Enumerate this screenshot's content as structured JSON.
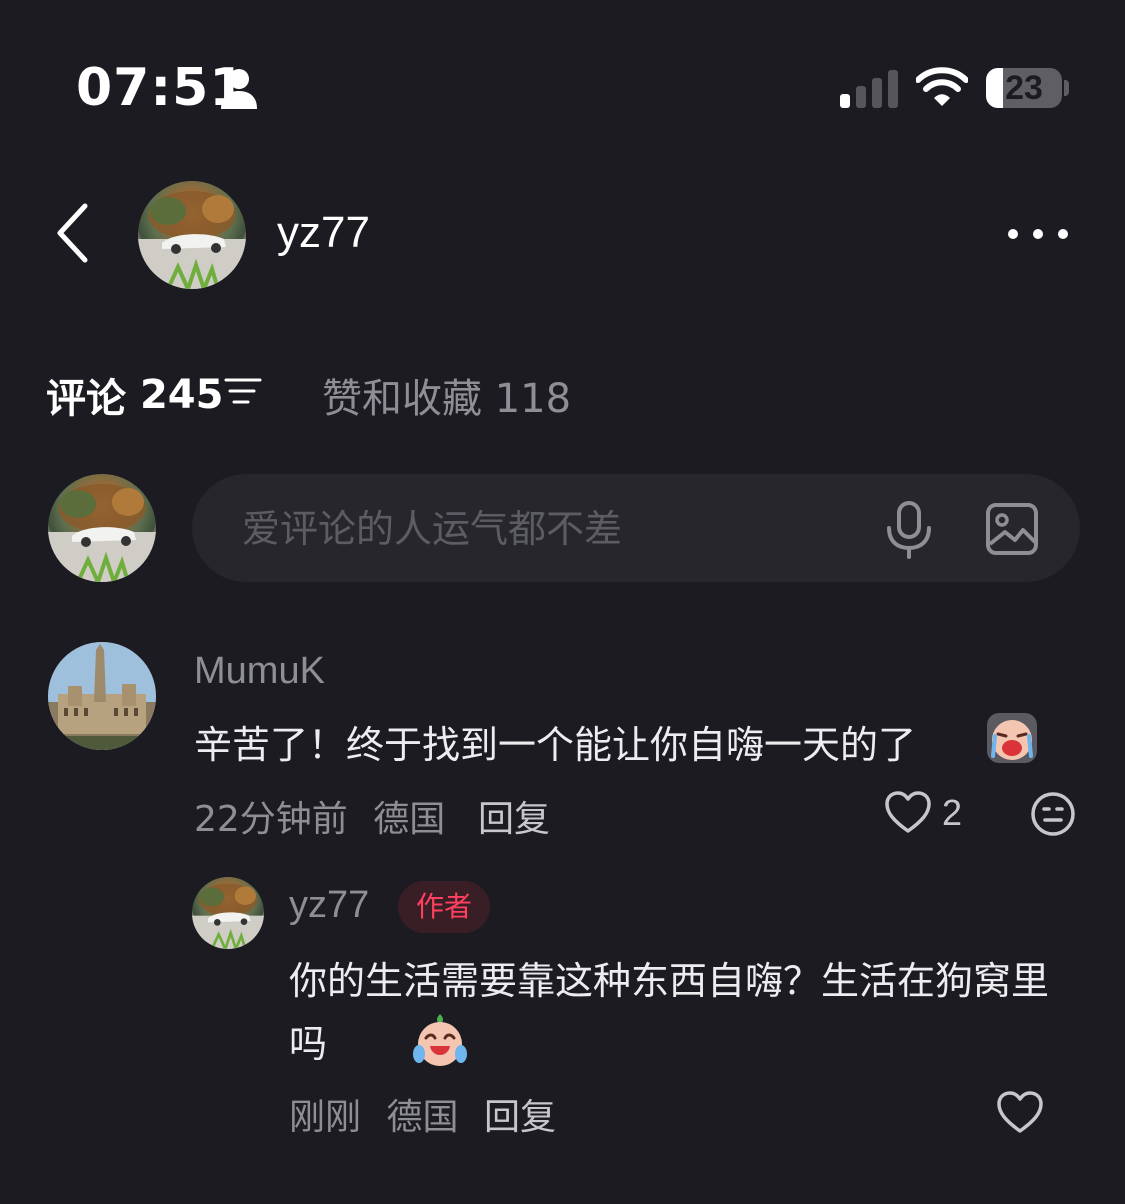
{
  "status_bar": {
    "time": "07:51",
    "battery": "23",
    "battery_level": 0.23
  },
  "header": {
    "username": "yz77"
  },
  "tabs": {
    "comments_label": "评论",
    "comments_count": "245",
    "likes_label": "赞和收藏 118"
  },
  "comment_input": {
    "placeholder": "爱评论的人运气都不差"
  },
  "comments": [
    {
      "author": "MumuK",
      "text": "辛苦了！终于找到一个能让你自嗨一天的了",
      "time": "22分钟前",
      "location": "德国",
      "reply_label": "回复",
      "likes": "2",
      "replies": [
        {
          "author": "yz77",
          "badge": "作者",
          "text": "你的生活需要靠这种东西自嗨？生活在狗窝里吗",
          "time": "刚刚",
          "location": "德国",
          "reply_label": "回复"
        }
      ]
    }
  ],
  "icons": {
    "status_person": "person-icon",
    "signal": "signal-icon",
    "wifi": "wifi-icon",
    "back": "back-icon",
    "more": "more-icon",
    "filter": "filter-icon",
    "mic": "mic-icon",
    "image": "image-icon",
    "like": "heart-icon",
    "emoji_react": "emoji-icon"
  },
  "colors": {
    "background": "#1b1b21",
    "input_background": "#26262c",
    "secondary_text": "#8e8e95",
    "author_badge": "#ff4060"
  }
}
